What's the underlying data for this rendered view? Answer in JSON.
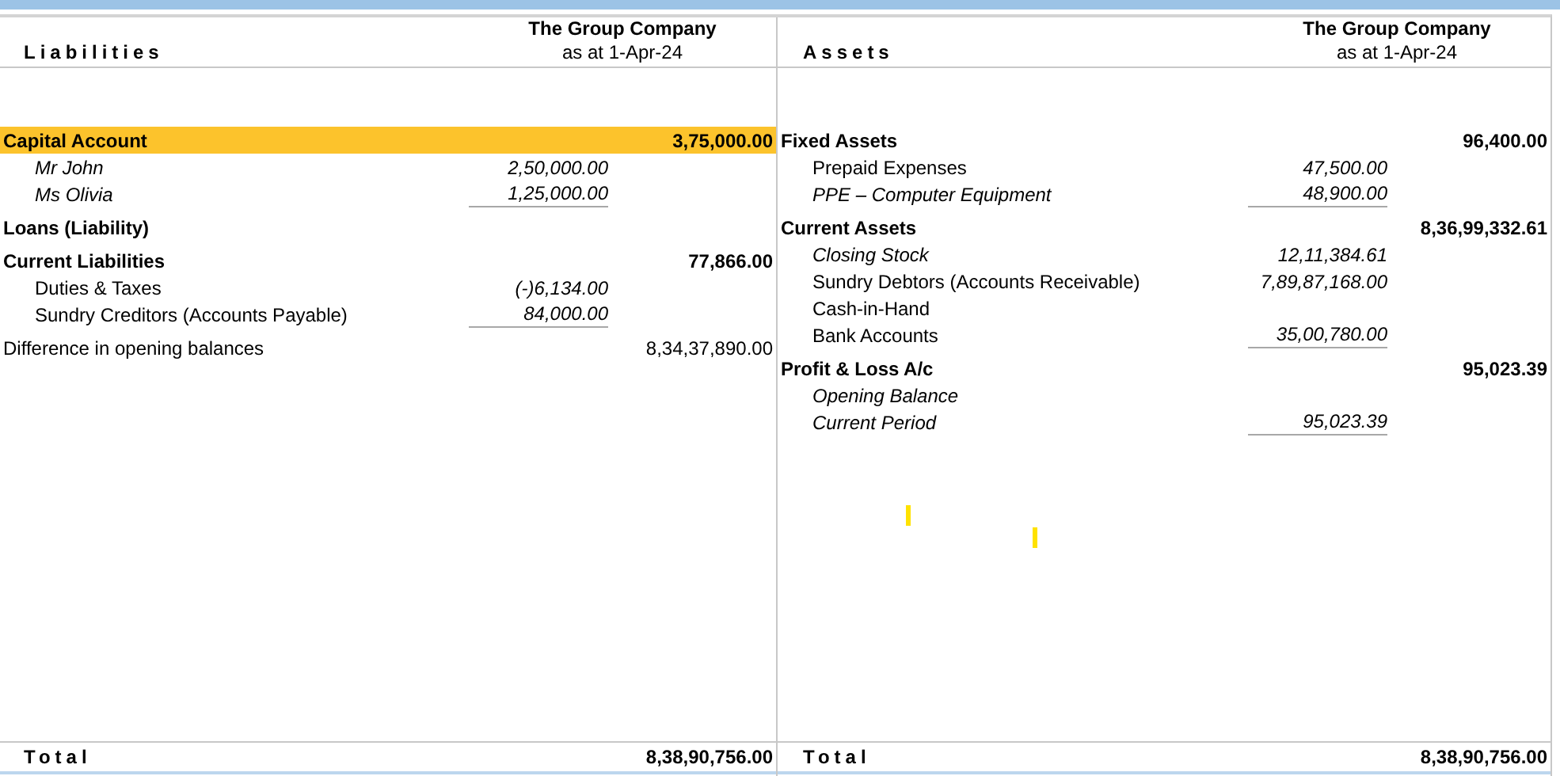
{
  "sections": [
    {
      "heading": "Liabilities",
      "company": "The Group Company",
      "period": "as at 1-Apr-24",
      "total_label": "Total",
      "total": "8,38,90,756.00",
      "groups": [
        {
          "kind": "group",
          "name": "Capital Account",
          "amount": "3,75,000.00",
          "selected": true,
          "children": [
            {
              "name": "Mr John",
              "amount": "2,50,000.00",
              "italic": true
            },
            {
              "name": "Ms Olivia",
              "amount": "1,25,000.00",
              "italic": true
            }
          ]
        },
        {
          "kind": "group",
          "name": "Loans (Liability)",
          "selected": false
        },
        {
          "kind": "group",
          "name": "Current Liabilities",
          "amount": "77,866.00",
          "selected": false,
          "children": [
            {
              "name": "Duties & Taxes",
              "amount": "(-)6,134.00",
              "italic": false
            },
            {
              "name": "Sundry Creditors (Accounts Payable)",
              "amount": "84,000.00",
              "italic": false
            }
          ]
        },
        {
          "kind": "plain",
          "name": "Difference in opening balances",
          "amount": "8,34,37,890.00",
          "selected": false
        }
      ]
    },
    {
      "heading": "Assets",
      "company": "The Group Company",
      "period": "as at 1-Apr-24",
      "total_label": "Total",
      "total": "8,38,90,756.00",
      "groups": [
        {
          "kind": "group",
          "name": "Fixed Assets",
          "amount": "96,400.00",
          "selected": false,
          "children": [
            {
              "name": "Prepaid Expenses",
              "amount": "47,500.00",
              "italic": false
            },
            {
              "name": "PPE – Computer Equipment",
              "amount": "48,900.00",
              "italic": true
            }
          ]
        },
        {
          "kind": "group",
          "name": "Current Assets",
          "amount": "8,36,99,332.61",
          "selected": false,
          "children": [
            {
              "name": "Closing Stock",
              "amount": "12,11,384.61",
              "italic": true
            },
            {
              "name": "Sundry Debtors (Accounts Receivable)",
              "amount": "7,89,87,168.00",
              "italic": false
            },
            {
              "name": "Cash-in-Hand",
              "italic": false
            },
            {
              "name": "Bank Accounts",
              "amount": "35,00,780.00",
              "italic": false
            }
          ]
        },
        {
          "kind": "group",
          "name": "Profit & Loss A/c",
          "amount": "95,023.39",
          "selected": false,
          "children": [
            {
              "name": "Opening Balance",
              "italic": true
            },
            {
              "name": "Current Period",
              "amount": "95,023.39",
              "italic": true
            }
          ]
        }
      ]
    }
  ]
}
